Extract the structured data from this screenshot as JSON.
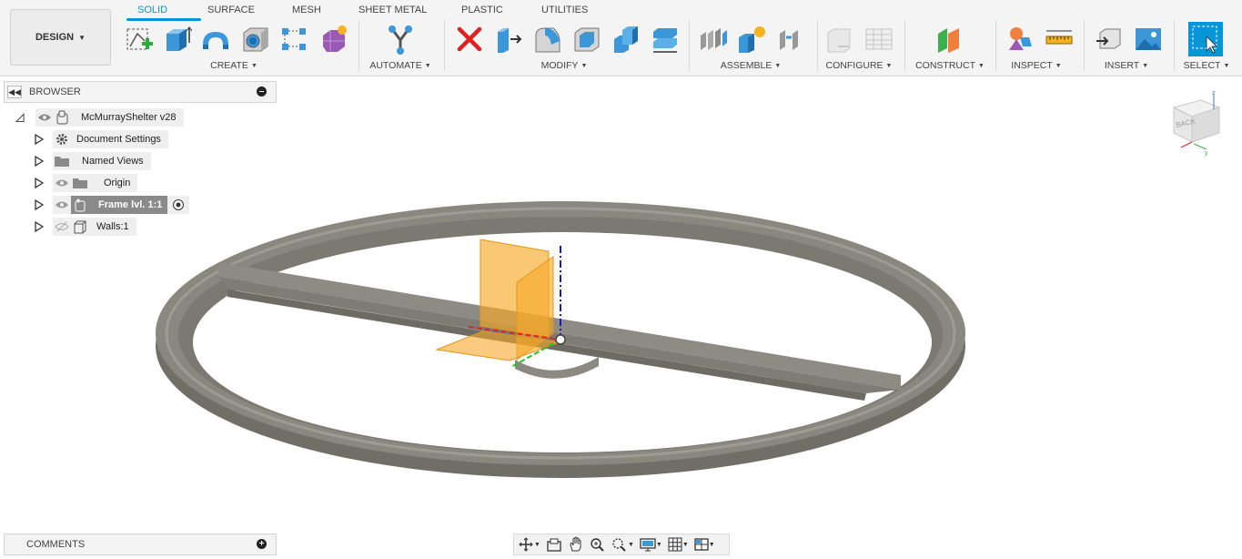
{
  "workspace": {
    "label": "DESIGN"
  },
  "tabs": [
    {
      "label": "SOLID",
      "active": true
    },
    {
      "label": "SURFACE",
      "active": false
    },
    {
      "label": "MESH",
      "active": false
    },
    {
      "label": "SHEET METAL",
      "active": false
    },
    {
      "label": "PLASTIC",
      "active": false
    },
    {
      "label": "UTILITIES",
      "active": false
    }
  ],
  "toolbar_groups": [
    {
      "label": "CREATE",
      "icons": [
        "create-sketch-icon",
        "extrude-icon",
        "revolve-icon",
        "hole-icon",
        "pattern-icon",
        "create-form-icon"
      ]
    },
    {
      "label": "AUTOMATE",
      "icons": [
        "automate-icon"
      ]
    },
    {
      "label": "MODIFY",
      "icons": [
        "delete-icon",
        "press-pull-icon",
        "fillet-icon",
        "shell-icon",
        "combine-icon",
        "align-icon"
      ]
    },
    {
      "label": "ASSEMBLE",
      "icons": [
        "new-component-icon",
        "component-star-icon",
        "joint-icon"
      ]
    },
    {
      "label": "CONFIGURE",
      "icons": [
        "configure-icon",
        "table-icon"
      ]
    },
    {
      "label": "CONSTRUCT",
      "icons": [
        "construct-plane-icon"
      ]
    },
    {
      "label": "INSPECT",
      "icons": [
        "inspect-icon",
        "measure-icon"
      ]
    },
    {
      "label": "INSERT",
      "icons": [
        "insert-icon",
        "insert-image-icon"
      ]
    },
    {
      "label": "SELECT",
      "icons": [
        "select-icon"
      ]
    }
  ],
  "browser": {
    "title": "BROWSER",
    "root": "McMurrayShelter v28",
    "items": [
      {
        "label": "Document Settings",
        "icon": "gear-icon"
      },
      {
        "label": "Named Views",
        "icon": "folder-icon"
      },
      {
        "label": "Origin",
        "icon": "folder-icon"
      },
      {
        "label": "Frame lvl. 1:1",
        "icon": "component-icon",
        "active": true
      },
      {
        "label": "Walls:1",
        "icon": "body-icon"
      }
    ]
  },
  "comments": {
    "title": "COMMENTS"
  },
  "viewcube": {
    "face": "BACK"
  },
  "colors": {
    "accent": "#0696d7",
    "model": "#7f7f77",
    "plane": "#f7a928"
  }
}
